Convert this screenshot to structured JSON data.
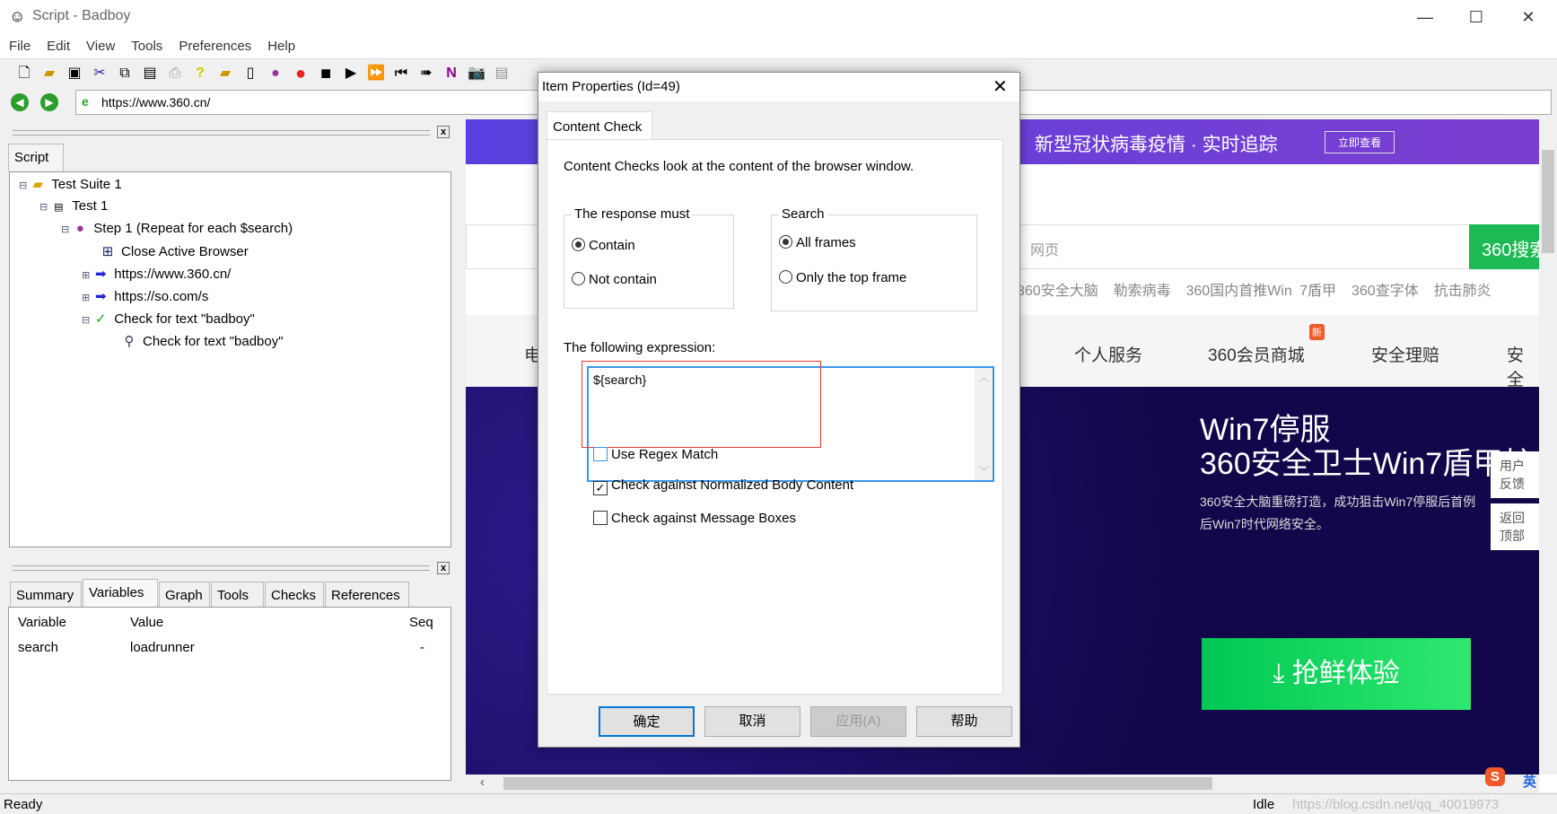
{
  "window": {
    "title": "Script - Badboy",
    "minimize": "—",
    "maximize": "☐",
    "close": "✕"
  },
  "menu": [
    "File",
    "Edit",
    "View",
    "Tools",
    "Preferences",
    "Help"
  ],
  "toolbar_icons": [
    "new-icon",
    "open-icon",
    "save-icon",
    "cut-icon",
    "copy-icon",
    "paste-icon",
    "print-icon",
    "help-icon",
    "add-suite-icon",
    "add-test-icon",
    "add-step-icon",
    "record-icon",
    "stop-icon",
    "play-icon",
    "play-all-icon",
    "rewind-icon",
    "step-forward-icon",
    "navigation-icon",
    "screenshot-icon",
    "report-icon"
  ],
  "address": {
    "url": "https://www.360.cn/"
  },
  "script_panel": {
    "tab": "Script",
    "close": "x",
    "tree": [
      {
        "label": "Test Suite 1",
        "icon": "folder-icon"
      },
      {
        "label": "Test 1",
        "icon": "test-icon"
      },
      {
        "label": "Step 1 (Repeat for each $search)",
        "icon": "step-icon"
      },
      {
        "label": "Close Active Browser",
        "icon": "window-icon"
      },
      {
        "label": "https://www.360.cn/",
        "icon": "request-arrow-icon"
      },
      {
        "label": "https://so.com/s",
        "icon": "request-arrow-icon"
      },
      {
        "label": "Check for text \"badboy\"",
        "icon": "checkmark-icon"
      },
      {
        "label": "Check for text \"badboy\"",
        "icon": "content-check-icon"
      }
    ]
  },
  "bottom_panel": {
    "close": "x",
    "tabs": [
      "Summary",
      "Variables",
      "Graph",
      "Tools",
      "Checks",
      "References"
    ],
    "active_tab": "Variables",
    "columns": [
      "Variable",
      "Value",
      "Seq"
    ],
    "rows": [
      {
        "variable": "search",
        "value": "loadrunner",
        "seq": "-"
      }
    ]
  },
  "status": {
    "left": "Ready",
    "right": "Idle",
    "watermark": "https://blog.csdn.net/qq_40019973"
  },
  "browser": {
    "banner": "新型冠状病毒疫情 · 实时追踪",
    "banner_button": "立即查看",
    "search_type": "网页",
    "search_button": "360搜索",
    "hot_links": [
      "360安全大脑",
      "勒索病毒",
      "360国内首推Win 7盾甲",
      "360查字体",
      "抗击肺炎"
    ],
    "nav": [
      "电",
      "个人服务",
      "360会员商城",
      "安全理赔",
      "安全"
    ],
    "nav_badge": "新",
    "hero_title1": "Win7停服",
    "hero_title2": "360安全卫士Win7盾甲护",
    "hero_desc1": "360安全大脑重磅打造，成功狙击Win7停服后首例",
    "hero_desc2": "后Win7时代网络安全。",
    "cta": "抢鲜体验",
    "side": [
      "用户反馈",
      "返回顶部"
    ],
    "ime": "英"
  },
  "dialog": {
    "title": "Item Properties (Id=49)",
    "tab": "Content Check",
    "description": "Content Checks look at the content of the browser window.",
    "response_group": "The response must",
    "response_options": [
      "Contain",
      "Not contain"
    ],
    "response_selected": "Contain",
    "search_group": "Search",
    "search_options": [
      "All frames",
      "Only the top frame"
    ],
    "search_selected": "All frames",
    "expression_label": "The following expression:",
    "expression": "${search}",
    "checkboxes": [
      {
        "label": "Use Regex Match",
        "checked": false
      },
      {
        "label": "Check against Normalized Body Content",
        "checked": true
      },
      {
        "label": "Check against Message Boxes",
        "checked": false
      }
    ],
    "buttons": {
      "ok": "确定",
      "cancel": "取消",
      "apply": "应用(A)",
      "help": "帮助"
    }
  },
  "colors": {
    "banner": "#6a3fd8",
    "green": "#1db954",
    "hero_bg": "#15084a",
    "highlight": "#e53935",
    "focus": "#0078d7"
  }
}
